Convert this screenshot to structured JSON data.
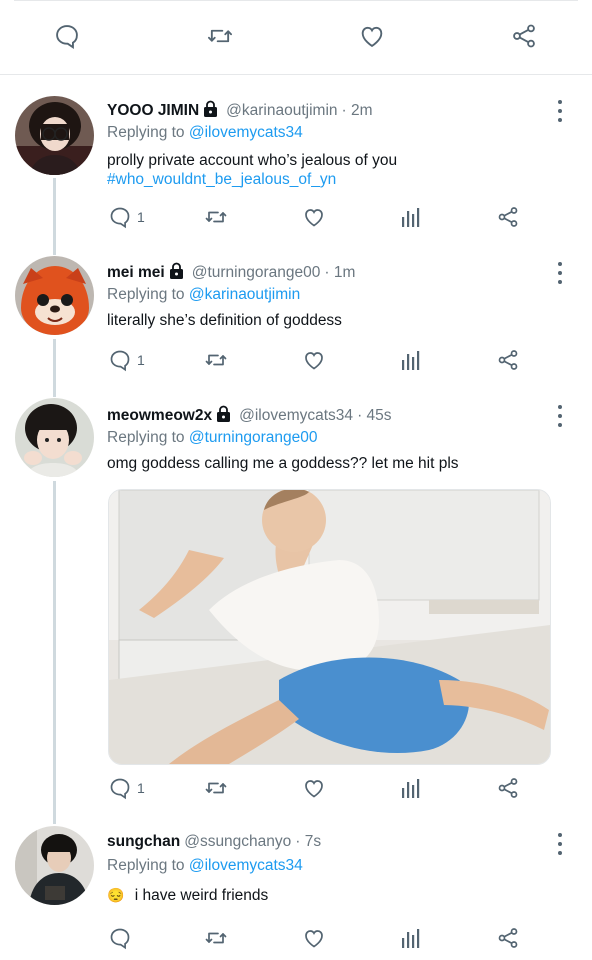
{
  "tweets": [
    {
      "name": "YOOO JIMIN",
      "handle": "@karinaoutjimin",
      "time": "· 2m",
      "reply_prefix": "Replying to",
      "reply_to": "@ilovemycats34",
      "text": "prolly private account who’s jealous of you",
      "hashtag": "#who_wouldnt_be_jealous_of_yn",
      "reply_count": "1"
    },
    {
      "name": "mei mei",
      "handle": "@turningorange00",
      "time": "· 1m",
      "reply_prefix": "Replying to",
      "reply_to": "@karinaoutjimin",
      "text": "literally she’s definition of goddess",
      "reply_count": "1"
    },
    {
      "name": "meowmeow2x",
      "handle": "@ilovemycats34",
      "time": "· 45s",
      "reply_prefix": "Replying to",
      "reply_to": "@turningorange00",
      "text": "omg goddess calling me a goddess?? let me hit pls",
      "reply_count": "1"
    },
    {
      "name": "sungchan",
      "handle": "@ssungchanyo",
      "time": "· 7s",
      "reply_prefix": "Replying to",
      "reply_to": "@ilovemycats34",
      "emoji": "😔",
      "text": "i have weird friends",
      "reply_count": ""
    }
  ],
  "colors": {
    "accent": "#1d9bf0",
    "icon": "#536471",
    "divider": "#e6e8ea"
  },
  "icons": [
    "comment-icon",
    "retweet-icon",
    "heart-icon",
    "share-icon",
    "analytics-icon",
    "lock-icon",
    "more-icon"
  ]
}
